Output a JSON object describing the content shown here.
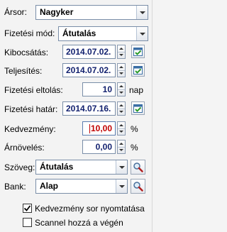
{
  "labels": {
    "arsor": "Ársor:",
    "fizetesi_mod": "Fizetési mód:",
    "kibocsatas": "Kibocsátás:",
    "teljesites": "Teljesítés:",
    "fizetesi_eltolas": "Fizetési eltolás:",
    "fizetesi_hatar": "Fizetési határ:",
    "kedvezmeny": "Kedvezmény:",
    "arnoveles": "Árnövelés:",
    "szoveg": "Szöveg:",
    "bank": "Bank:"
  },
  "values": {
    "arsor": "Nagyker",
    "fizetesi_mod": "Átutalás",
    "kibocsatas": "2014.07.02.",
    "teljesites": "2014.07.02.",
    "fizetesi_eltolas": "10",
    "fizetesi_hatar": "2014.07.16.",
    "kedvezmeny": "10,00",
    "arnoveles": "0,00",
    "szoveg": "Átutalás",
    "bank": "Alap"
  },
  "units": {
    "nap": "nap",
    "percent1": "%",
    "percent2": "%"
  },
  "checkboxes": {
    "kedvezmeny_sor": {
      "label": "Kedvezmény sor nyomtatása",
      "checked": true
    },
    "scannel": {
      "label": "Scannel hozzá a végén",
      "checked": false
    }
  }
}
